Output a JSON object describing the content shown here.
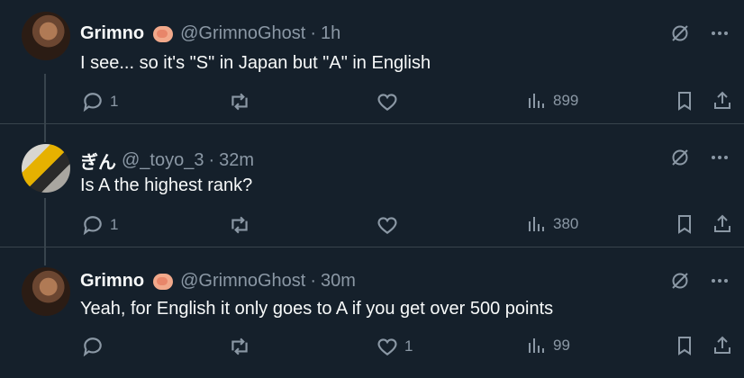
{
  "tweets": [
    {
      "name": "Grimno",
      "handle": "@GrimnoGhost",
      "dot": "·",
      "time": "1h",
      "text": "I see... so it's \"S\" in Japan but \"A\" in English",
      "replies": "1",
      "retweets": "",
      "likes": "",
      "views": "899"
    },
    {
      "name": "ぎん",
      "handle": "@_toyo_3",
      "dot": "·",
      "time": "32m",
      "text": "Is A the highest rank?",
      "replies": "1",
      "retweets": "",
      "likes": "",
      "views": "380"
    },
    {
      "name": "Grimno",
      "handle": "@GrimnoGhost",
      "dot": "·",
      "time": "30m",
      "text": "Yeah, for English it only goes to A if you get over 500 points",
      "replies": "",
      "retweets": "",
      "likes": "1",
      "views": "99"
    }
  ],
  "colors": {
    "background": "#15202b",
    "text": "#f7f9f9",
    "muted": "#8b98a5",
    "divider": "#38444d"
  }
}
